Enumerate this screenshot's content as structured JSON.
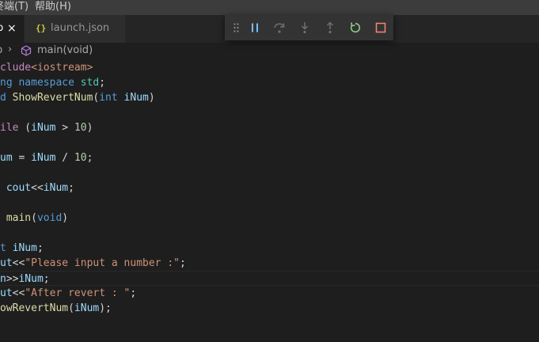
{
  "menubar": {
    "terminal": "终端(T)",
    "help": "帮助(H)"
  },
  "tabs": [
    {
      "label": "p",
      "active": true,
      "close": "×"
    },
    {
      "label": "launch.json",
      "icon": "{}",
      "active": false
    }
  ],
  "debug_toolbar": {
    "buttons": [
      "drag-handle-icon",
      "pause-icon",
      "step-over-icon",
      "step-into-icon",
      "step-out-icon",
      "restart-icon",
      "stop-icon"
    ],
    "colors": {
      "pause": "#75beff",
      "step": "#75beff",
      "restart": "#89d185",
      "stop": "#f48771"
    }
  },
  "breadcrumb": {
    "file": "p",
    "separator": "›",
    "function": "main(void)"
  },
  "code_lines": [
    [
      [
        "ctrl",
        "clude"
      ],
      [
        "str",
        "<iostream>"
      ]
    ],
    [
      [
        "kw",
        "ng"
      ],
      [
        "pl",
        " "
      ],
      [
        "kw",
        "namespace"
      ],
      [
        "pl",
        " "
      ],
      [
        "typ",
        "std"
      ],
      [
        "pl",
        ";"
      ]
    ],
    [
      [
        "kw",
        "d"
      ],
      [
        "pl",
        " "
      ],
      [
        "fn",
        "ShowRevertNum"
      ],
      [
        "pl",
        "("
      ],
      [
        "kw",
        "int"
      ],
      [
        "pl",
        " "
      ],
      [
        "var",
        "iNum"
      ],
      [
        "pl",
        ")"
      ]
    ],
    [],
    [
      [
        "ctrl",
        "ile"
      ],
      [
        "pl",
        " ("
      ],
      [
        "var",
        "iNum"
      ],
      [
        "pl",
        " > "
      ],
      [
        "num",
        "10"
      ],
      [
        "pl",
        ")"
      ]
    ],
    [],
    [
      [
        "var",
        "um"
      ],
      [
        "pl",
        " = "
      ],
      [
        "var",
        "iNum"
      ],
      [
        "pl",
        " / "
      ],
      [
        "num",
        "10"
      ],
      [
        "pl",
        ";"
      ]
    ],
    [],
    [
      [
        "pl",
        " "
      ],
      [
        "var",
        "cout"
      ],
      [
        "pl",
        "<<"
      ],
      [
        "var",
        "iNum"
      ],
      [
        "pl",
        ";"
      ]
    ],
    [],
    [
      [
        "pl",
        " "
      ],
      [
        "fn",
        "main"
      ],
      [
        "pl",
        "("
      ],
      [
        "kw",
        "void"
      ],
      [
        "pl",
        ")"
      ]
    ],
    [],
    [
      [
        "kw",
        "t"
      ],
      [
        "pl",
        " "
      ],
      [
        "var",
        "iNum"
      ],
      [
        "pl",
        ";"
      ]
    ],
    [
      [
        "var",
        "ut"
      ],
      [
        "pl",
        "<<"
      ],
      [
        "str",
        "\"Please input a number :\""
      ],
      [
        "pl",
        ";"
      ]
    ],
    [
      [
        "var",
        "n"
      ],
      [
        "pl",
        ">>"
      ],
      [
        "var",
        "iNum"
      ],
      [
        "pl",
        ";"
      ]
    ],
    [
      [
        "var",
        "ut"
      ],
      [
        "pl",
        "<<"
      ],
      [
        "str",
        "\"After revert : \""
      ],
      [
        "pl",
        ";"
      ]
    ],
    [
      [
        "fn",
        "owRevertNum"
      ],
      [
        "pl",
        "("
      ],
      [
        "var",
        "iNum"
      ],
      [
        "pl",
        ");"
      ]
    ]
  ],
  "current_line_index": 14
}
